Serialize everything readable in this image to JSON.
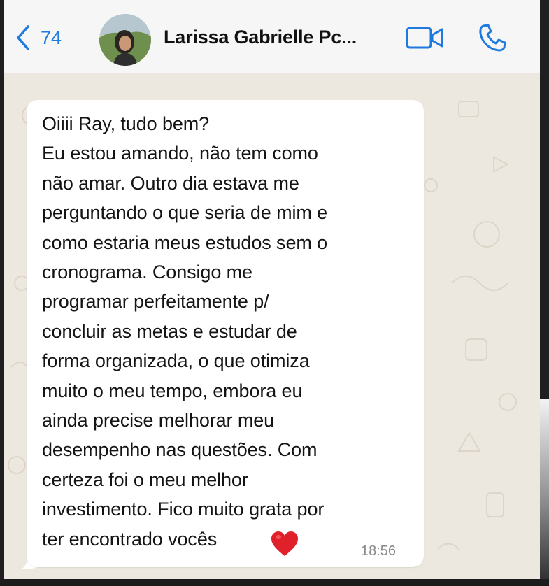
{
  "header": {
    "back_count": "74",
    "contact_name": "Larissa Gabrielle Pc...",
    "icons": {
      "back": "chevron-left-icon",
      "video": "video-camera-icon",
      "call": "phone-icon"
    }
  },
  "message": {
    "text": "Oiiii Ray, tudo bem?\nEu estou amando, não tem como\nnão amar. Outro dia estava me\nperguntando o que seria de mim e\ncomo estaria meus estudos sem o\ncronograma. Consigo me\nprogramar perfeitamente p/\nconcluir as metas e estudar de\nforma organizada, o que otimiza\nmuito o meu tempo, embora eu\nainda precise melhorar meu\ndesempenho nas questões. Com\ncerteza foi o meu melhor\ninvestimento. Fico muito grata por\nter encontrado vocês",
    "emoji": "heart-icon",
    "time": "18:56"
  },
  "colors": {
    "accent": "#1f7ae0",
    "chat_background": "#ede8df",
    "bubble": "#ffffff",
    "heart": "#e0202a"
  }
}
